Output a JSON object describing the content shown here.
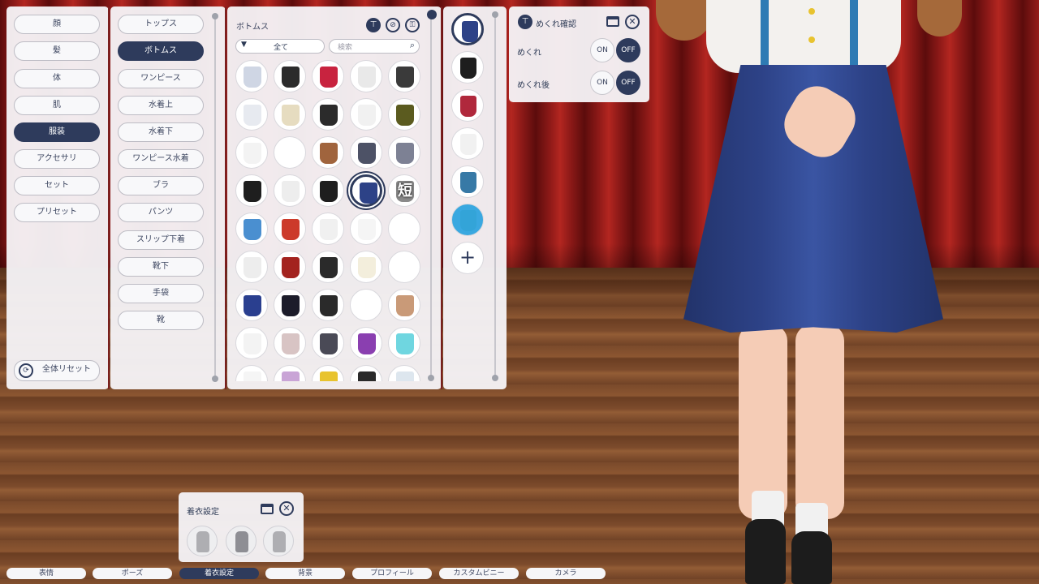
{
  "left_categories": [
    "顔",
    "髪",
    "体",
    "肌",
    "服装",
    "アクセサリ",
    "セット",
    "プリセット"
  ],
  "left_active": "服装",
  "reset_all_label": "全体リセット",
  "sub_categories": [
    "トップス",
    "ボトムス",
    "ワンピース",
    "水着上",
    "水着下",
    "ワンピース水着",
    "ブラ",
    "パンツ",
    "スリップ下着",
    "靴下",
    "手袋",
    "靴"
  ],
  "sub_active": "ボトムス",
  "items_panel": {
    "title": "ボトムス",
    "filter_value": "全て",
    "search_placeholder": "検索",
    "short_badge": "短"
  },
  "item_colors": [
    [
      "#cfd6e4",
      "#2b2b2b",
      "#c8233f",
      "#e9e9e9",
      "#3a3a3a"
    ],
    [
      "#e7eaf0",
      "#e6dcc0",
      "#2b2b2b",
      "#f1f1f1",
      "#5b5b1f"
    ],
    [
      "#f3f3f3",
      "#ffffff",
      "#a0643d",
      "#4d5266",
      "#7d8194"
    ],
    [
      "#1e1e1e",
      "#ededed",
      "#1e1e1e",
      "#2d4287",
      "#8a8a8a"
    ],
    [
      "#4a8fd0",
      "#cc3a2a",
      "#f0f0f0",
      "#f5f5f5",
      "#ffffff"
    ],
    [
      "#ededed",
      "#a3231f",
      "#2a2a2a",
      "#f3eedc",
      "#ffffff"
    ],
    [
      "#2a3f8f",
      "#1c1c2a",
      "#2a2a2a",
      "#ffffff",
      "#c99a78"
    ],
    [
      "#f3f3f3",
      "#d8c4c4",
      "#4a4a56",
      "#8a3fb0",
      "#6fd6e0"
    ],
    [
      "#f5f5f5",
      "#c9a4d6",
      "#e8c32e",
      "#2a2a2a",
      "#dde6ee"
    ]
  ],
  "selected_item": "navy-pleated-skirt",
  "color_variants": [
    "#2d4287",
    "#1e1e1e",
    "#b0283c",
    "#f1f1f1",
    "#3779a6",
    "#33a4d8"
  ],
  "add_variant_icon": "plus-icon",
  "flip_panel": {
    "title": "めくれ確認",
    "rows": [
      {
        "label": "めくれ",
        "on": "ON",
        "off": "OFF",
        "selected": "OFF"
      },
      {
        "label": "めくれ後",
        "on": "ON",
        "off": "OFF",
        "selected": "OFF"
      }
    ]
  },
  "dress_panel": {
    "title": "着衣設定"
  },
  "bottom_tabs": [
    "表情",
    "ポーズ",
    "着衣設定",
    "背景",
    "プロフィール",
    "カスタムビニー",
    "カメラ"
  ],
  "bottom_active": "着衣設定",
  "accent": "#2e3b5c",
  "icons": {
    "reset": "reset-icon",
    "hanger": "hanger-icon",
    "ban": "ban-icon",
    "lock": "lock-icon",
    "close": "close-icon",
    "window": "window-icon",
    "dropdown": "triangle-down-icon",
    "search": "search-icon"
  }
}
